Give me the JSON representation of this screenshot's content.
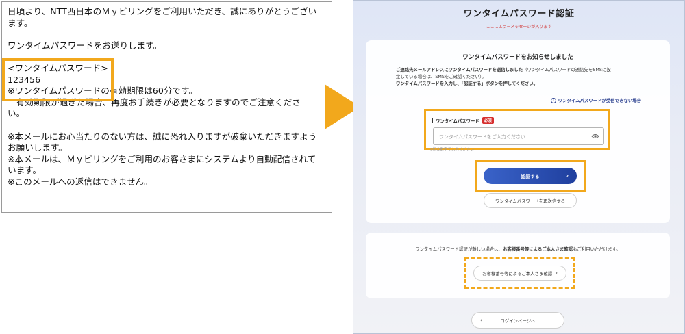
{
  "email": {
    "lines": [
      "日頃より、NTT西日本のＭｙビリングをご利用いただき、誠にありがとうござい",
      "ます。",
      "",
      "ワンタイムパスワードをお送りします。",
      "",
      "<ワンタイムパスワード>",
      "123456",
      "※ワンタイムパスワードの有効期限は60分です。",
      "　有効期限が過ぎた場合、再度お手続きが必要となりますのでご注意くださ",
      "い。",
      "",
      "※本メールにお心当たりのない方は、誠に恐れ入りますが破棄いただきますよう",
      "お願いします。",
      "※本メールは、Ｍｙビリングをご利用のお客さまにシステムより自動配信されて",
      "います。",
      "※このメールへの返信はできません。"
    ]
  },
  "screen": {
    "title": "ワンタイムパスワード認証",
    "error_message": "ここにエラーメッセージが入ります",
    "card1": {
      "heading": "ワンタイムパスワードをお知らせしました",
      "desc_line1_bold": "ご連絡先メールアドレスにワンタイムパスワードを送信しました",
      "desc_line1_rest": "（ワンタイムパスワードの送信先をSMSに設",
      "desc_line2": "定している場合は、SMSをご確認ください）。",
      "desc_line3": "ワンタイムパスワードを入力し、「認証する」ボタンを押してください。",
      "help_link": "ワンタイムパスワードが受信できない場合",
      "field_label": "ワンタイムパスワード",
      "required_badge": "必須",
      "input_placeholder": "ワンタイムパスワードをご入力ください",
      "input_value": "",
      "hint": "6桁の数字で入力ください",
      "verify_button": "認証する",
      "resend_button": "ワンタイムパスワードを再送信する"
    },
    "card2": {
      "text_prefix": "ワンタイムパスワード認証が難しい場合は、",
      "text_bold": "お客様番号等によるご本人さま確認",
      "text_suffix": "もご利用いただけます。",
      "identity_button": "お客様番号等によるご本人さま確認"
    },
    "login_button": "ログインページへ"
  },
  "colors": {
    "highlight": "#f2a81c",
    "primary": "#2a4fb5",
    "error": "#d23c3c"
  }
}
